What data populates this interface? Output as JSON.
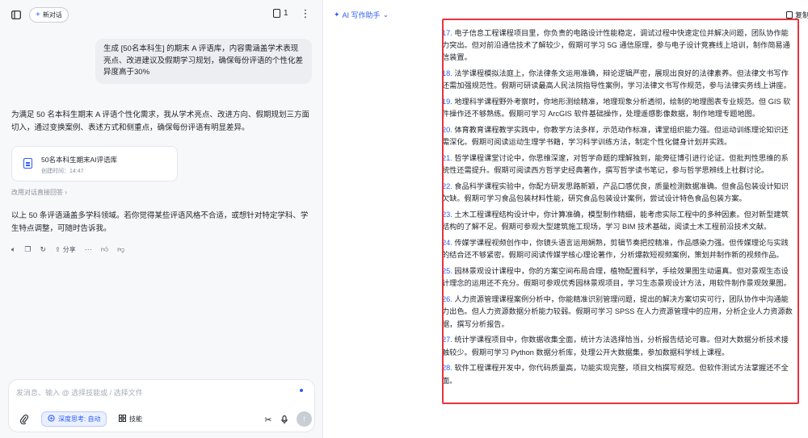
{
  "left": {
    "new_chat_label": "新对话",
    "doc_count": "1",
    "user_message": "生成 [50名本科生] 的期末 A 评语库，内容需涵盖学术表现亮点、改进建议及假期学习规划，确保每份评语的个性化差异度高于30%",
    "reply_intro": "为满足 50 名本科生期末 A 评语个性化需求，我从学术亮点、改进方向、假期规划三方面切入，通过变换案例、表述方式和侧重点，确保每份评语有明显差异。",
    "file": {
      "name": "50名本科生期末AI评语库",
      "time": "创建时间：14:47"
    },
    "modify_link": "改用对话直接回答",
    "reply_outro": "以上 50 条评语涵盖多学科领域。若你觉得某些评语风格不合适，或想针对特定学科、学生特点调整，可随时告诉我。",
    "share_label": "分享",
    "input_placeholder": "发消息、输入 @ 选择技能或 / 选择文件",
    "deep_think_label": "深度思考: 自动",
    "skills_label": "技能"
  },
  "right": {
    "ai_assist_label": "AI 写作助手",
    "copy_label": "复制",
    "items": [
      {
        "num": "17.",
        "text": "电子信息工程课程项目里，你负责的电路设计性能稳定，调试过程中快速定位并解决问题，团队协作能力突出。但对前沿通信技术了解较少，假期可学习 5G 通信原理，参与电子设计竞赛线上培训，制作简易通信装置。"
      },
      {
        "num": "18.",
        "text": "法学课程模拟法庭上，你法律条文运用准确，辩论逻辑严密，展现出良好的法律素养。但法律文书写作还需加强规范性。假期可研读最高人民法院指导性案例，学习法律文书写作规范，参与法律实务线上讲座。"
      },
      {
        "num": "19.",
        "text": "地理科学课程野外考察时，你地形测绘精准，地理现象分析透彻，绘制的地理图表专业规范。但 GIS 软件操作还不够熟练。假期可学习 ArcGIS 软件基础操作，处理遥感影像数据，制作地理专题地图。"
      },
      {
        "num": "20.",
        "text": "体育教育课程教学实践中，你教学方法多样，示范动作标准，课堂组织能力强。但运动训练理论知识还需深化。假期可阅读运动生理学书籍，学习科学训练方法，制定个性化健身计划并实践。"
      },
      {
        "num": "21.",
        "text": "哲学课程课堂讨论中，你思维深邃，对哲学命题的理解独到，能旁征博引进行论证。但批判性思维的系统性还需提升。假期可阅读西方哲学史经典著作，撰写哲学读书笔记，参与哲学思辨线上社群讨论。"
      },
      {
        "num": "22.",
        "text": "食品科学课程实验中，你配方研发思路新颖，产品口感优良，质量检测数据准确。但食品包装设计知识欠缺。假期可学习食品包装材料性能，研究食品包装设计案例，尝试设计特色食品包装方案。"
      },
      {
        "num": "23.",
        "text": "土木工程课程结构设计中，你计算准确，模型制作精细，能考虑实际工程中的多种因素。但对新型建筑结构的了解不足。假期可参观大型建筑施工现场，学习 BIM 技术基础，阅读土木工程前沿技术文献。"
      },
      {
        "num": "24.",
        "text": "传媒学课程视频创作中，你镜头语言运用娴熟，剪辑节奏把控精准，作品感染力强。但传媒理论与实践的结合还不够紧密。假期可阅读传媒学核心理论著作，分析爆款短视频案例，策划并制作新的视频作品。"
      },
      {
        "num": "25.",
        "text": "园林景观设计课程中，你的方案空间布局合理，植物配置科学，手绘效果图生动逼真。但对景观生态设计理念的运用还不充分。假期可参观优秀园林景观项目，学习生态景观设计方法，用软件制作景观效果图。"
      },
      {
        "num": "26.",
        "text": "人力资源管理课程案例分析中，你能精准识别管理问题，提出的解决方案切实可行，团队协作中沟通能力出色。但人力资源数据分析能力较弱。假期可学习 SPSS 在人力资源管理中的应用，分析企业人力资源数据，撰写分析报告。"
      },
      {
        "num": "27.",
        "text": "统计学课程项目中，你数据收集全面，统计方法选择恰当，分析报告结论可靠。但对大数据分析技术接触较少。假期可学习 Python 数据分析库，处理公开大数据集，参加数据科学线上课程。"
      },
      {
        "num": "28.",
        "text": "软件工程课程开发中，你代码质量高，功能实现完整，项目文档撰写规范。但软件测试方法掌握还不全面。"
      }
    ]
  }
}
